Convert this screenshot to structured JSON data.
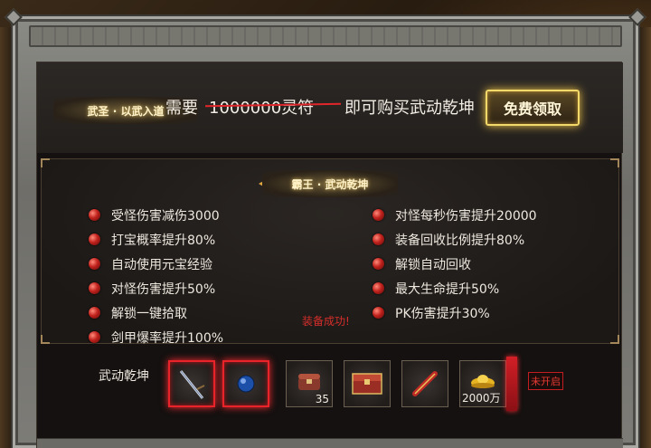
{
  "header": {
    "title_badge": "武圣 · 以武入道",
    "need_label": "需要",
    "original_price": "1000000灵符",
    "buy_text": "即可购买武动乾坤",
    "free_button": "免费领取"
  },
  "effects": {
    "badge": "霸王 · 武动乾坤",
    "left": [
      "受怪伤害减伤3000",
      "打宝概率提升80%",
      "自动使用元宝经验",
      "对怪伤害提升50%",
      "解锁一键拾取",
      "剑甲爆率提升100%"
    ],
    "right": [
      "对怪每秒伤害提升20000",
      "装备回收比例提升80%",
      "解锁自动回收",
      "最大生命提升50%",
      "PK伤害提升30%"
    ],
    "equip_message": "装备成功!"
  },
  "items": {
    "row_label": "武动乾坤",
    "slots": [
      {
        "icon": "sword-icon",
        "qty": ""
      },
      {
        "icon": "orb-icon",
        "qty": ""
      },
      {
        "icon": "chest-icon",
        "qty": "35"
      },
      {
        "icon": "treasure-box-icon",
        "qty": ""
      },
      {
        "icon": "scroll-icon",
        "qty": ""
      },
      {
        "icon": "gold-ingot-icon",
        "qty": "2000万"
      }
    ],
    "locked_label": "未开启"
  },
  "colors": {
    "highlight_red": "#e8242a",
    "gold": "#f3d96a"
  }
}
